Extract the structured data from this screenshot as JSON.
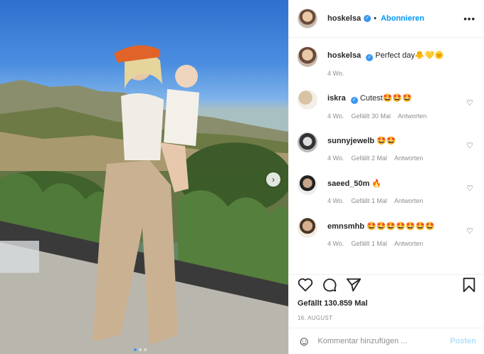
{
  "header": {
    "username": "hoskelsa",
    "follow_label": "Abonnieren",
    "separator": "•",
    "more_label": "•••"
  },
  "caption": {
    "username": "hoskelsa",
    "text": "Perfect day🐥💛🌞",
    "age": "4 Wo."
  },
  "comments": [
    {
      "username": "iskra",
      "verified": true,
      "text": "Cutest🤩🤩🤩",
      "age": "4 Wo.",
      "likes": "Gefällt 30 Mal",
      "reply": "Antworten"
    },
    {
      "username": "sunnyjewelb",
      "verified": false,
      "text": "🤩🤩",
      "age": "4 Wo.",
      "likes": "Gefällt 2 Mal",
      "reply": "Antworten"
    },
    {
      "username": "saeed_50m",
      "verified": false,
      "text": "🔥",
      "age": "4 Wo.",
      "likes": "Gefällt 1 Mal",
      "reply": "Antworten"
    },
    {
      "username": "emnsmhb",
      "verified": false,
      "text": "🤩🤩🤩🤩🤩🤩🤩",
      "age": "4 Wo.",
      "likes": "Gefällt 1 Mal",
      "reply": "Antworten"
    }
  ],
  "stats": {
    "likes": "Gefällt 130.859 Mal",
    "date": "16. AUGUST"
  },
  "compose": {
    "placeholder": "Kommentar hinzufügen ...",
    "post_label": "Posten"
  },
  "carousel": {
    "slides": 3,
    "active": 0
  },
  "colors": {
    "accent": "#0095f6",
    "verified": "#3897f0",
    "muted": "#8e8e8e"
  }
}
